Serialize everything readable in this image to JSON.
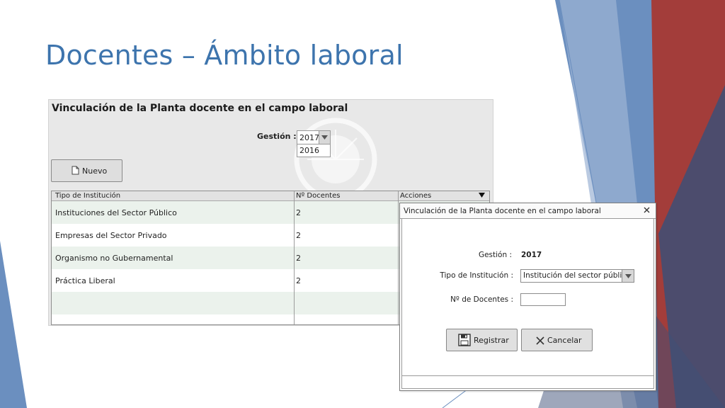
{
  "slide": {
    "title": "Docentes – Ámbito laboral"
  },
  "colors": {
    "title_blue": "#3d74ad",
    "deco_blue": "#6b8fbf",
    "deco_red": "#a33d3a",
    "deco_navy": "#3d4f77"
  },
  "panel": {
    "title": "Vinculación de la Planta docente en el campo laboral",
    "gestion_label": "Gestión :",
    "gestion_selected": "2017",
    "gestion_option": "2016",
    "nuevo_label": "Nuevo",
    "table": {
      "headers": [
        "Tipo de Institución",
        "Nº Docentes",
        "Acciones"
      ],
      "rows": [
        [
          "Instituciones del Sector Público",
          "2"
        ],
        [
          "Empresas del Sector Privado",
          "2"
        ],
        [
          "Organismo no Gubernamental",
          "2"
        ],
        [
          "Práctica Liberal",
          "2"
        ]
      ]
    }
  },
  "dialog": {
    "title": "Vinculación de la Planta docente en el campo laboral",
    "gestion_label": "Gestión :",
    "gestion_value": "2017",
    "tipo_label": "Tipo de Institución :",
    "tipo_value": "Institución del sector público",
    "ndocentes_label": "Nº de Docentes :",
    "ndocentes_value": "",
    "registrar_label": "Registrar",
    "cancelar_label": "Cancelar"
  },
  "icons": {
    "new_document": "document-icon",
    "save": "floppy-disk-icon",
    "cancel": "x-icon",
    "close": "close-icon",
    "dropdown": "triangle-down-icon"
  }
}
